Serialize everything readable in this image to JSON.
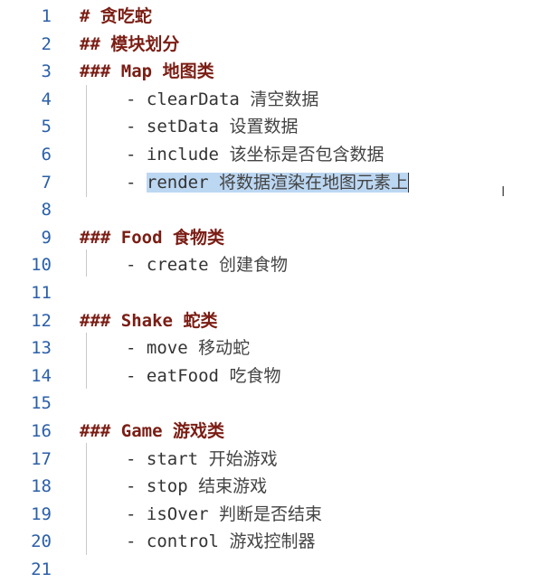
{
  "editor": {
    "lines": [
      {
        "n": "1",
        "indent": 1,
        "marker": "#",
        "code": "",
        "cn": "贪吃蛇",
        "selected": false
      },
      {
        "n": "2",
        "indent": 1,
        "marker": "##",
        "code": "",
        "cn": "模块划分",
        "selected": false
      },
      {
        "n": "3",
        "indent": 1,
        "marker": "###",
        "code": "Map",
        "cn": "地图类",
        "selected": false
      },
      {
        "n": "4",
        "indent": 2,
        "marker": "-",
        "code": "clearData",
        "cn": "清空数据",
        "selected": false
      },
      {
        "n": "5",
        "indent": 2,
        "marker": "-",
        "code": "setData",
        "cn": "设置数据",
        "selected": false
      },
      {
        "n": "6",
        "indent": 2,
        "marker": "-",
        "code": "include",
        "cn": "该坐标是否包含数据",
        "selected": false
      },
      {
        "n": "7",
        "indent": 2,
        "marker": "-",
        "code": "render",
        "cn": "将数据渲染在地图元素上",
        "selected": true
      },
      {
        "n": "8",
        "indent": 0,
        "marker": "",
        "code": "",
        "cn": "",
        "selected": false
      },
      {
        "n": "9",
        "indent": 1,
        "marker": "###",
        "code": "Food",
        "cn": "食物类",
        "selected": false
      },
      {
        "n": "10",
        "indent": 2,
        "marker": "-",
        "code": "create",
        "cn": "创建食物",
        "selected": false
      },
      {
        "n": "11",
        "indent": 0,
        "marker": "",
        "code": "",
        "cn": "",
        "selected": false
      },
      {
        "n": "12",
        "indent": 1,
        "marker": "###",
        "code": "Shake",
        "cn": "蛇类",
        "selected": false
      },
      {
        "n": "13",
        "indent": 2,
        "marker": "-",
        "code": "move",
        "cn": "移动蛇",
        "selected": false
      },
      {
        "n": "14",
        "indent": 2,
        "marker": "-",
        "code": "eatFood",
        "cn": "吃食物",
        "selected": false
      },
      {
        "n": "15",
        "indent": 0,
        "marker": "",
        "code": "",
        "cn": "",
        "selected": false
      },
      {
        "n": "16",
        "indent": 1,
        "marker": "###",
        "code": "Game",
        "cn": "游戏类",
        "selected": false
      },
      {
        "n": "17",
        "indent": 2,
        "marker": "-",
        "code": "start",
        "cn": "开始游戏",
        "selected": false
      },
      {
        "n": "18",
        "indent": 2,
        "marker": "-",
        "code": "stop",
        "cn": "结束游戏",
        "selected": false
      },
      {
        "n": "19",
        "indent": 2,
        "marker": "-",
        "code": "isOver",
        "cn": "判断是否结束",
        "selected": false
      },
      {
        "n": "20",
        "indent": 2,
        "marker": "-",
        "code": "control",
        "cn": "游戏控制器",
        "selected": false
      },
      {
        "n": "21",
        "indent": 0,
        "marker": "",
        "code": "",
        "cn": "",
        "selected": false
      }
    ],
    "colors": {
      "line_number": "#2b5fa8",
      "heading": "#7a1d14",
      "selection": "#bcd7f2"
    }
  },
  "mouse_cursor_icon": "text-cursor-icon"
}
